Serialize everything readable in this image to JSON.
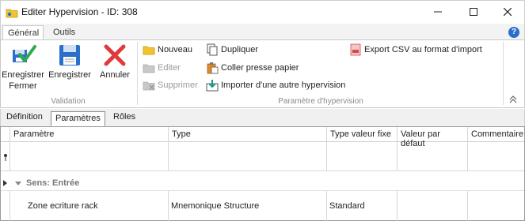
{
  "window": {
    "title": "Editer Hypervision - ID: 308",
    "minimize": "—",
    "maximize": "☐",
    "close": "✕"
  },
  "ribbon_tabs": [
    "Général",
    "Outils"
  ],
  "help_label": "?",
  "groups": {
    "validation": {
      "label": "Validation",
      "buttons": {
        "save_close": "Enregistrer Fermer",
        "save_close_l1": "Enregistrer",
        "save_close_l2": "Fermer",
        "save": "Enregistrer",
        "cancel": "Annuler"
      }
    },
    "param": {
      "label": "Paramètre d'hypervision",
      "nouveau": "Nouveau",
      "editer": "Editer",
      "supprimer": "Supprimer",
      "dupliquer": "Dupliquer",
      "coller": "Coller presse papier",
      "importer": "Importer d'une autre hypervision",
      "export": "Export CSV au format d'import"
    }
  },
  "inner_tabs": [
    "Définition",
    "Paramètres",
    "Rôles"
  ],
  "grid": {
    "columns": [
      "Paramètre",
      "Type",
      "Type valeur fixe",
      "Valeur par défaut",
      "Commentaire"
    ],
    "group_label": "Sens: Entrée",
    "rows": [
      {
        "parametre": "Zone ecriture rack",
        "type": "Mnemonique Structure",
        "type_valeur_fixe": "Standard",
        "valeur_defaut": "",
        "commentaire": ""
      }
    ]
  },
  "colors": {
    "accent_blue": "#2a6fc9",
    "cancel_red": "#e03a3a",
    "disabled_gray": "#9a9a9a"
  }
}
